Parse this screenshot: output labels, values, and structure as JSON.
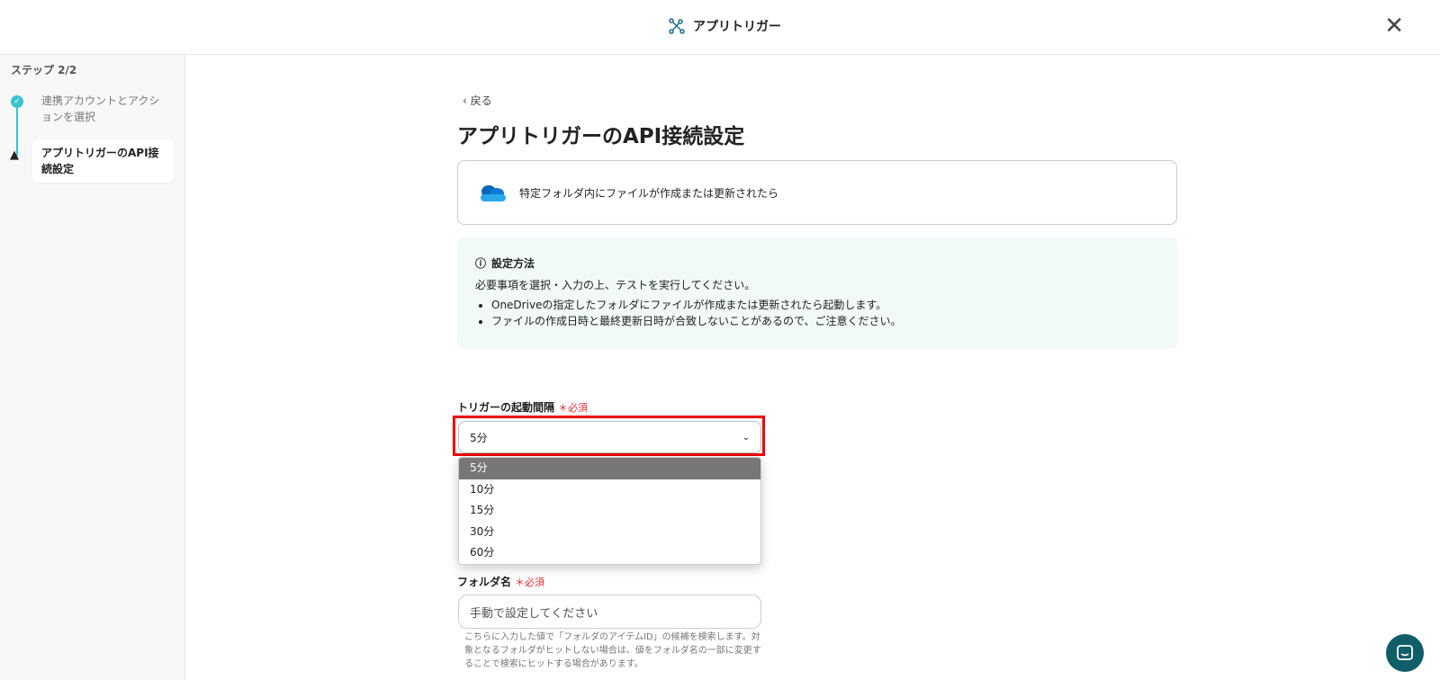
{
  "header": {
    "title": "アプリトリガー"
  },
  "sidebar": {
    "step_count": "ステップ 2/2",
    "steps": [
      {
        "label": "連携アカウントとアクションを選択",
        "status": "done"
      },
      {
        "label": "アプリトリガーのAPI接続設定",
        "status": "warning"
      }
    ]
  },
  "main": {
    "back": "戻る",
    "title": "アプリトリガーのAPI接続設定",
    "trigger_card": "特定フォルダ内にファイルが作成または更新されたら",
    "info": {
      "heading": "設定方法",
      "intro": "必要事項を選択・入力の上、テストを実行してください。",
      "bullets": [
        "OneDriveの指定したフォルダにファイルが作成または更新されたら起動します。",
        "ファイルの作成日時と最終更新日時が合致しないことがあるので、ご注意ください。"
      ]
    },
    "interval": {
      "label": "トリガーの起動間隔",
      "required": "必須",
      "value": "5分",
      "options": [
        "5分",
        "10分",
        "15分",
        "30分",
        "60分"
      ]
    },
    "folder": {
      "label": "フォルダ名",
      "required": "必須",
      "placeholder": "手動で設定してください",
      "help": "こちらに入力した値で「フォルダのアイテムID」の候補を検索します。対象となるフォルダがヒットしない場合は、値をフォルダ名の一部に変更することで検索にヒットする場合があります。"
    }
  },
  "colors": {
    "accent": "#3cc3d2",
    "highlight": "#e00000",
    "required": "#d33333",
    "chat": "#0f5e68"
  }
}
